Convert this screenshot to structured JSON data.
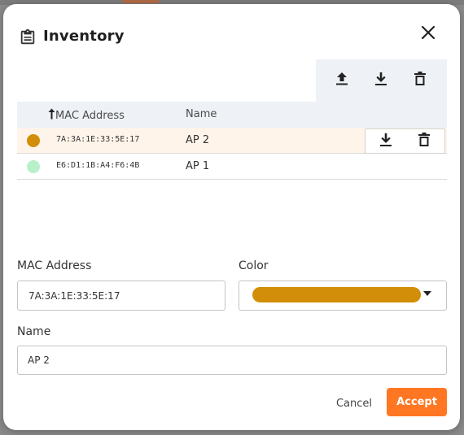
{
  "dialog": {
    "title": "Inventory",
    "header_icon": "clipboard-icon",
    "close_icon": "close-icon"
  },
  "toolbar": {
    "icons": [
      "upload-icon",
      "download-icon",
      "trash-icon"
    ]
  },
  "table": {
    "columns": {
      "mac": "MAC Address",
      "name": "Name",
      "sort_icon": "sort-ascending-icon"
    },
    "rows": [
      {
        "color": "#d28e08",
        "mac": "7A:3A:1E:33:5E:17",
        "name": "AP 2",
        "selected": true
      },
      {
        "color": "#b7f0c9",
        "mac": "E6:D1:1B:A4:F6:4B",
        "name": "AP 1",
        "selected": false
      }
    ]
  },
  "form": {
    "mac_label": "MAC Address",
    "mac_value": "7A:3A:1E:33:5E:17",
    "color_label": "Color",
    "color_value": "#d28e08",
    "name_label": "Name",
    "name_value": "AP 2"
  },
  "footer": {
    "cancel_label": "Cancel",
    "accept_label": "Accept"
  },
  "colors": {
    "accent": "#ff7722",
    "selected_row": "#fff4ea",
    "header_bg": "#eef1f5"
  }
}
